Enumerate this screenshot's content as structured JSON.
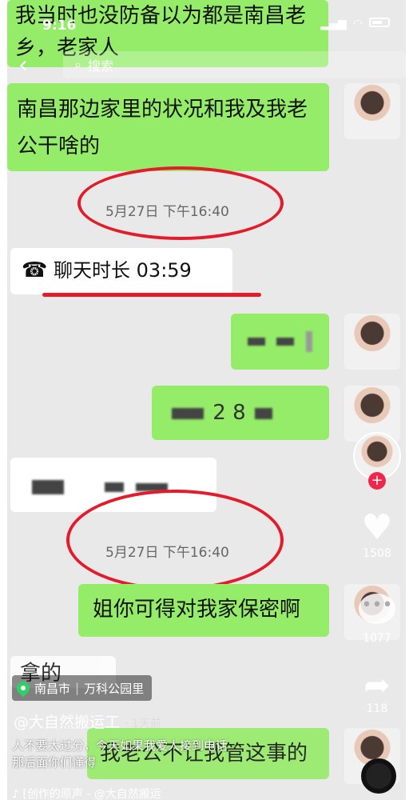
{
  "status_bar": {
    "time": "9:16"
  },
  "nav": {
    "search_placeholder": "搜索",
    "back_icon": "chevron-left-icon"
  },
  "messages": [
    {
      "side": "right",
      "text": "我当时也没防备以为都是南昌老乡，老家人"
    },
    {
      "side": "right",
      "text": "南昌那边家里的状况和我及我老公干啥的"
    }
  ],
  "timestamp_1": "5月27日 下午16:40",
  "call_record": {
    "label": "聊天时长 03:59",
    "icon": "phone-hangup-icon"
  },
  "blurred_messages": [
    {
      "side": "right",
      "visible": "·"
    },
    {
      "side": "right",
      "visible": "2 8"
    },
    {
      "side": "left",
      "visible": ""
    }
  ],
  "timestamp_2": "5月27日 下午16:40",
  "message_after": "姐你可得对我家保密啊",
  "partial_left": "拿的",
  "bottom_bubble": "我老公不让我管这事的",
  "sidebar": {
    "likes": "1508",
    "comments": "1077",
    "shares": "118"
  },
  "location": {
    "city": "南昌市",
    "place": "万科公园里"
  },
  "author": {
    "name": "@大自然搬运工",
    "date": "· 1天前"
  },
  "description": {
    "line1": "人不要太过分，今天如果我爱人接到电话",
    "line2": "那后面你们懂得"
  },
  "music": "♪ [创作的原声 - @大自然搬运"
}
